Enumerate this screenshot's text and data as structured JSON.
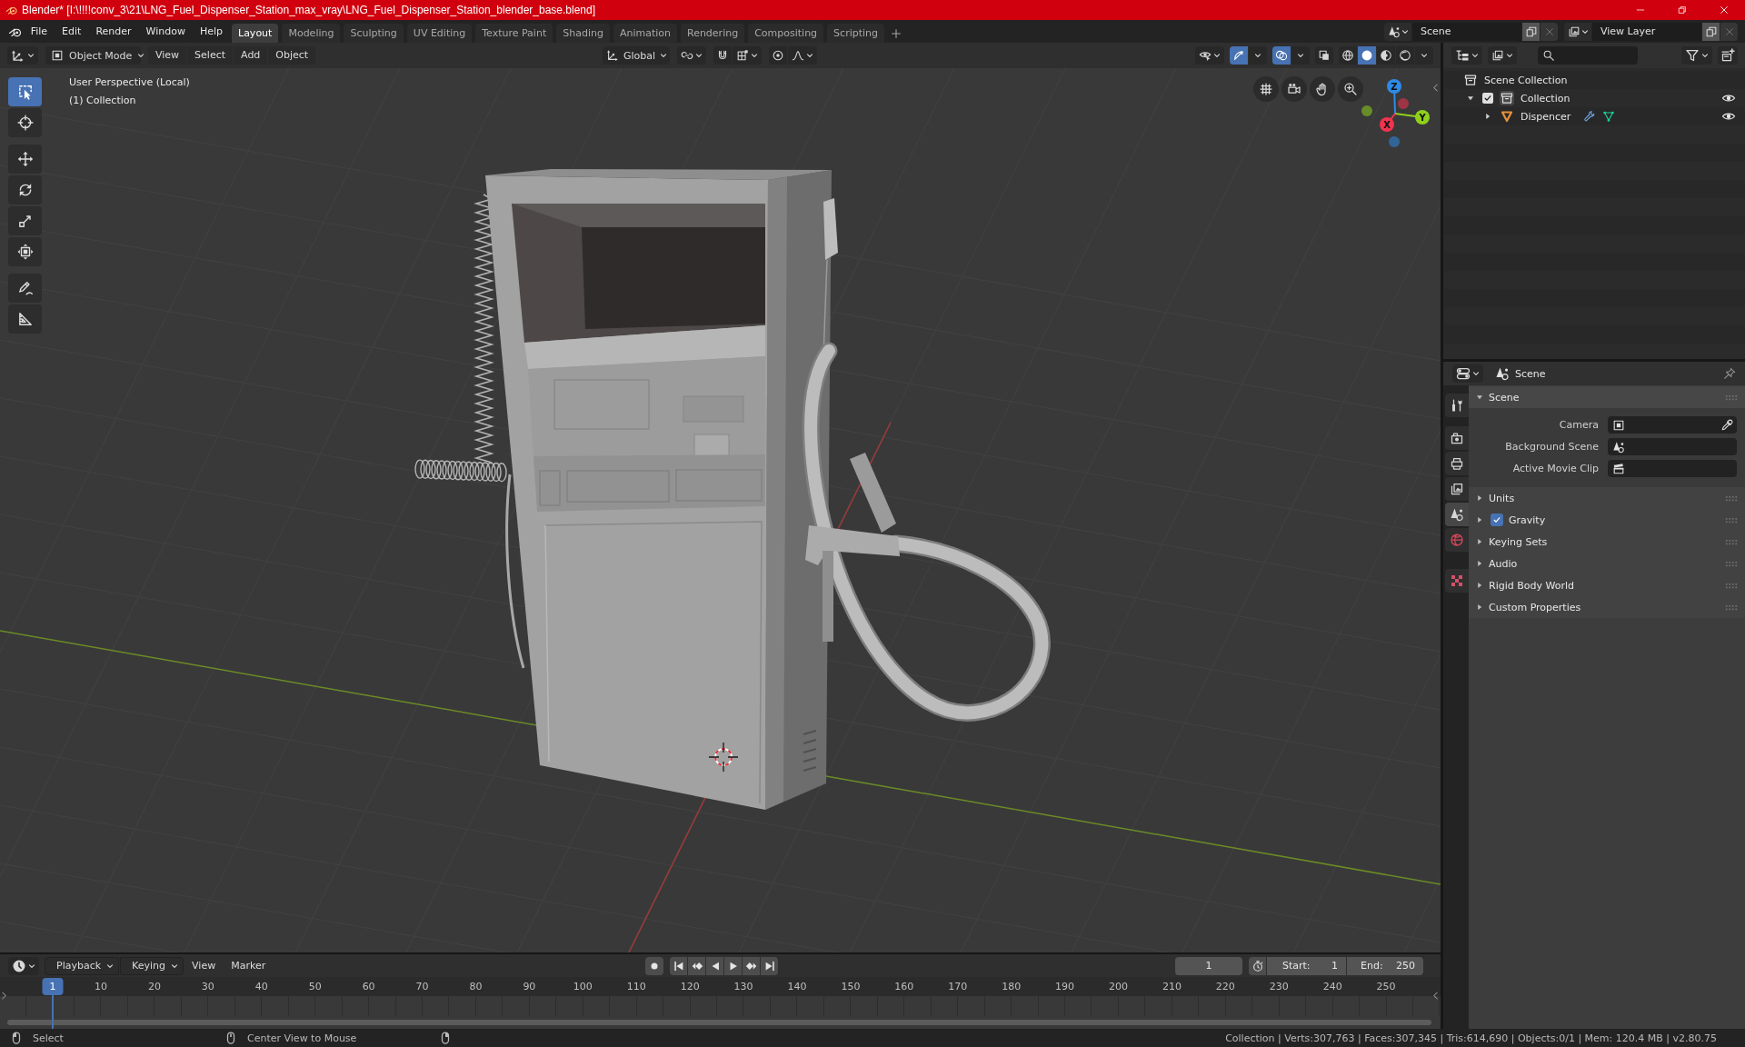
{
  "window": {
    "title": "Blender* [I:\\!!!!conv_3\\21\\LNG_Fuel_Dispenser_Station_max_vray\\LNG_Fuel_Dispenser_Station_blender_base.blend]"
  },
  "menu": [
    "File",
    "Edit",
    "Render",
    "Window",
    "Help"
  ],
  "workspace_tabs": [
    {
      "label": "Layout",
      "selected": true
    },
    {
      "label": "Modeling",
      "selected": false
    },
    {
      "label": "Sculpting",
      "selected": false
    },
    {
      "label": "UV Editing",
      "selected": false
    },
    {
      "label": "Texture Paint",
      "selected": false
    },
    {
      "label": "Shading",
      "selected": false
    },
    {
      "label": "Animation",
      "selected": false
    },
    {
      "label": "Rendering",
      "selected": false
    },
    {
      "label": "Compositing",
      "selected": false
    },
    {
      "label": "Scripting",
      "selected": false
    }
  ],
  "scene_selector": {
    "value": "Scene"
  },
  "view_layer_selector": {
    "value": "View Layer"
  },
  "viewport_header": {
    "mode": "Object Mode",
    "menus": [
      "View",
      "Select",
      "Add",
      "Object"
    ],
    "orientation": "Global",
    "toggles": [
      {
        "kind": "gizmos",
        "on": true
      },
      {
        "kind": "overlays",
        "on": true
      },
      {
        "kind": "xray",
        "on": false
      }
    ],
    "shading": [
      {
        "kind": "wireframe",
        "selected": false
      },
      {
        "kind": "solid",
        "selected": true
      },
      {
        "kind": "material",
        "selected": false
      },
      {
        "kind": "rendered",
        "selected": false
      }
    ]
  },
  "viewport": {
    "view_name": "User Perspective (Local)",
    "collection_label": "(1) Collection",
    "tools": [
      {
        "kind": "select-box",
        "selected": true
      },
      {
        "kind": "cursor",
        "selected": false
      },
      {
        "kind": "move",
        "selected": false
      },
      {
        "kind": "rotate",
        "selected": false
      },
      {
        "kind": "scale",
        "selected": false
      },
      {
        "kind": "transform",
        "selected": false
      },
      {
        "kind": "annotate",
        "selected": false
      },
      {
        "kind": "measure",
        "selected": false
      }
    ],
    "navigation_gizmo": {
      "axes": [
        {
          "label": "Z",
          "color": "#2e8ae6"
        },
        {
          "label": "Y",
          "color": "#8fd11a"
        },
        {
          "label": "X",
          "color": "#f0334f"
        }
      ]
    }
  },
  "outliner": {
    "tree": [
      {
        "label": "Scene Collection",
        "kind": "scene-collection",
        "children": [
          {
            "label": "Collection",
            "kind": "collection",
            "expanded": true,
            "checked": true,
            "visible": true,
            "children": [
              {
                "label": "Dispencer",
                "kind": "mesh-object",
                "expanded": false,
                "visible": true,
                "badges": [
                  {
                    "kind": "modifier"
                  },
                  {
                    "kind": "mesh-data"
                  }
                ]
              }
            ]
          }
        ]
      }
    ]
  },
  "properties": {
    "context": "Scene",
    "tabs": [
      {
        "kind": "tool",
        "selected": false
      },
      {
        "kind": "render",
        "selected": false
      },
      {
        "kind": "output",
        "selected": false
      },
      {
        "kind": "view-layer",
        "selected": false
      },
      {
        "kind": "scene",
        "selected": true
      },
      {
        "kind": "world",
        "selected": false
      },
      {
        "kind": "texture",
        "selected": false
      }
    ],
    "panels": [
      {
        "title": "Scene",
        "expanded": true,
        "fields": [
          {
            "label": "Camera",
            "kind": "object"
          },
          {
            "label": "Background Scene",
            "kind": "scene"
          },
          {
            "label": "Active Movie Clip",
            "kind": "movie-clip"
          }
        ]
      },
      {
        "title": "Units",
        "expanded": false
      },
      {
        "title": "Gravity",
        "expanded": false,
        "toggle": {
          "checked": true
        }
      },
      {
        "title": "Keying Sets",
        "expanded": false
      },
      {
        "title": "Audio",
        "expanded": false
      },
      {
        "title": "Rigid Body World",
        "expanded": false
      },
      {
        "title": "Custom Properties",
        "expanded": false
      }
    ]
  },
  "timeline": {
    "menus": [
      {
        "label": "Playback",
        "kind": "dropdown"
      },
      {
        "label": "Keying",
        "kind": "dropdown"
      },
      {
        "label": "View",
        "kind": "menu"
      },
      {
        "label": "Marker",
        "kind": "menu"
      }
    ],
    "current_frame": "1",
    "start_label": "Start:",
    "start": "1",
    "end_label": "End:",
    "end": "250",
    "ruler": [
      {
        "label": "1",
        "selected": true
      },
      {
        "label": "10",
        "selected": false
      },
      {
        "label": "20",
        "selected": false
      },
      {
        "label": "30",
        "selected": false
      },
      {
        "label": "40",
        "selected": false
      },
      {
        "label": "50",
        "selected": false
      },
      {
        "label": "60",
        "selected": false
      },
      {
        "label": "70",
        "selected": false
      },
      {
        "label": "80",
        "selected": false
      },
      {
        "label": "90",
        "selected": false
      },
      {
        "label": "100",
        "selected": false
      },
      {
        "label": "110",
        "selected": false
      },
      {
        "label": "120",
        "selected": false
      },
      {
        "label": "130",
        "selected": false
      },
      {
        "label": "140",
        "selected": false
      },
      {
        "label": "150",
        "selected": false
      },
      {
        "label": "160",
        "selected": false
      },
      {
        "label": "170",
        "selected": false
      },
      {
        "label": "180",
        "selected": false
      },
      {
        "label": "190",
        "selected": false
      },
      {
        "label": "200",
        "selected": false
      },
      {
        "label": "210",
        "selected": false
      },
      {
        "label": "220",
        "selected": false
      },
      {
        "label": "230",
        "selected": false
      },
      {
        "label": "240",
        "selected": false
      },
      {
        "label": "250",
        "selected": false
      }
    ]
  },
  "status_bar": {
    "hints": [
      {
        "kind": "mouse-left",
        "label": "Select"
      },
      {
        "kind": "mouse-middle",
        "label": "Center View to Mouse"
      },
      {
        "kind": "mouse-right"
      }
    ],
    "stats": "Collection | Verts:307,763 | Faces:307,345 | Tris:614,690 | Objects:0/1 | Mem: 120.4 MB | v2.80.75"
  }
}
